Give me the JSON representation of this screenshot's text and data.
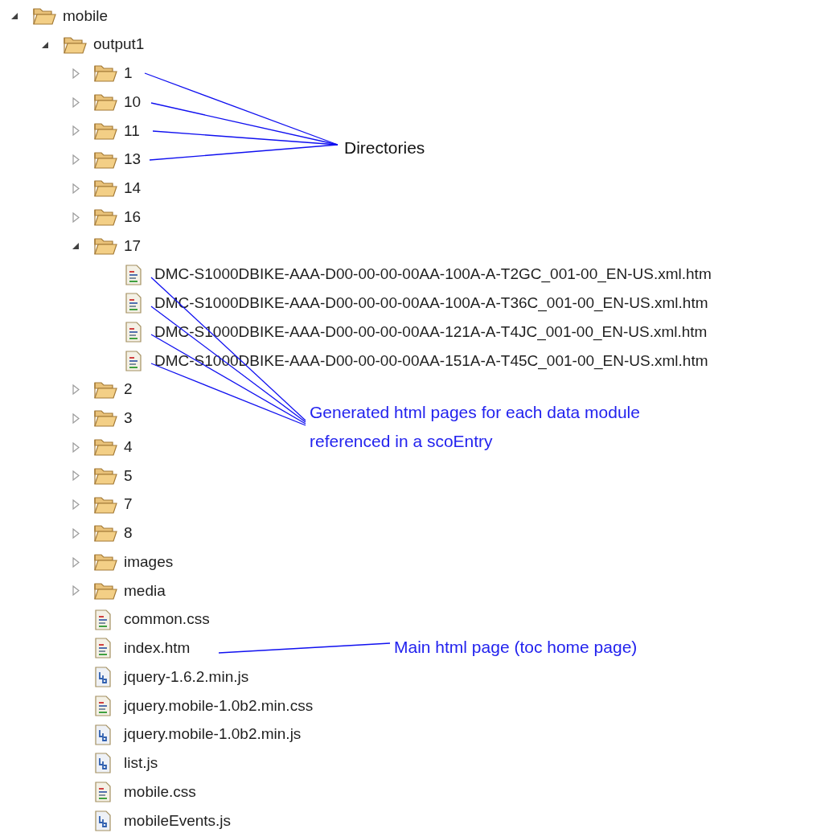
{
  "tree": [
    {
      "label": "mobile",
      "kind": "folder",
      "expanded": true,
      "children": [
        {
          "label": "output1",
          "kind": "folder",
          "expanded": true,
          "children": [
            {
              "label": "1",
              "kind": "folder",
              "expanded": false
            },
            {
              "label": "10",
              "kind": "folder",
              "expanded": false
            },
            {
              "label": "11",
              "kind": "folder",
              "expanded": false
            },
            {
              "label": "13",
              "kind": "folder",
              "expanded": false
            },
            {
              "label": "14",
              "kind": "folder",
              "expanded": false
            },
            {
              "label": "16",
              "kind": "folder",
              "expanded": false
            },
            {
              "label": "17",
              "kind": "folder",
              "expanded": true,
              "children": [
                {
                  "label": "DMC-S1000DBIKE-AAA-D00-00-00-00AA-100A-A-T2GC_001-00_EN-US.xml.htm",
                  "kind": "page"
                },
                {
                  "label": "DMC-S1000DBIKE-AAA-D00-00-00-00AA-100A-A-T36C_001-00_EN-US.xml.htm",
                  "kind": "page"
                },
                {
                  "label": "DMC-S1000DBIKE-AAA-D00-00-00-00AA-121A-A-T4JC_001-00_EN-US.xml.htm",
                  "kind": "page"
                },
                {
                  "label": "DMC-S1000DBIKE-AAA-D00-00-00-00AA-151A-A-T45C_001-00_EN-US.xml.htm",
                  "kind": "page"
                }
              ]
            },
            {
              "label": "2",
              "kind": "folder",
              "expanded": false
            },
            {
              "label": "3",
              "kind": "folder",
              "expanded": false
            },
            {
              "label": "4",
              "kind": "folder",
              "expanded": false
            },
            {
              "label": "5",
              "kind": "folder",
              "expanded": false
            },
            {
              "label": "7",
              "kind": "folder",
              "expanded": false
            },
            {
              "label": "8",
              "kind": "folder",
              "expanded": false
            },
            {
              "label": "images",
              "kind": "folder",
              "expanded": false
            },
            {
              "label": "media",
              "kind": "folder",
              "expanded": false
            },
            {
              "label": "common.css",
              "kind": "page"
            },
            {
              "label": "index.htm",
              "kind": "page"
            },
            {
              "label": "jquery-1.6.2.min.js",
              "kind": "script"
            },
            {
              "label": "jquery.mobile-1.0b2.min.css",
              "kind": "page"
            },
            {
              "label": "jquery.mobile-1.0b2.min.js",
              "kind": "script"
            },
            {
              "label": "list.js",
              "kind": "script"
            },
            {
              "label": "mobile.css",
              "kind": "page"
            },
            {
              "label": "mobileEvents.js",
              "kind": "script"
            }
          ]
        }
      ]
    }
  ],
  "annotations": [
    {
      "text": "Directories"
    },
    {
      "text": "Generated html pages for each data module referenced in a scoEntry"
    },
    {
      "text": "Main html page (toc home page)"
    }
  ]
}
